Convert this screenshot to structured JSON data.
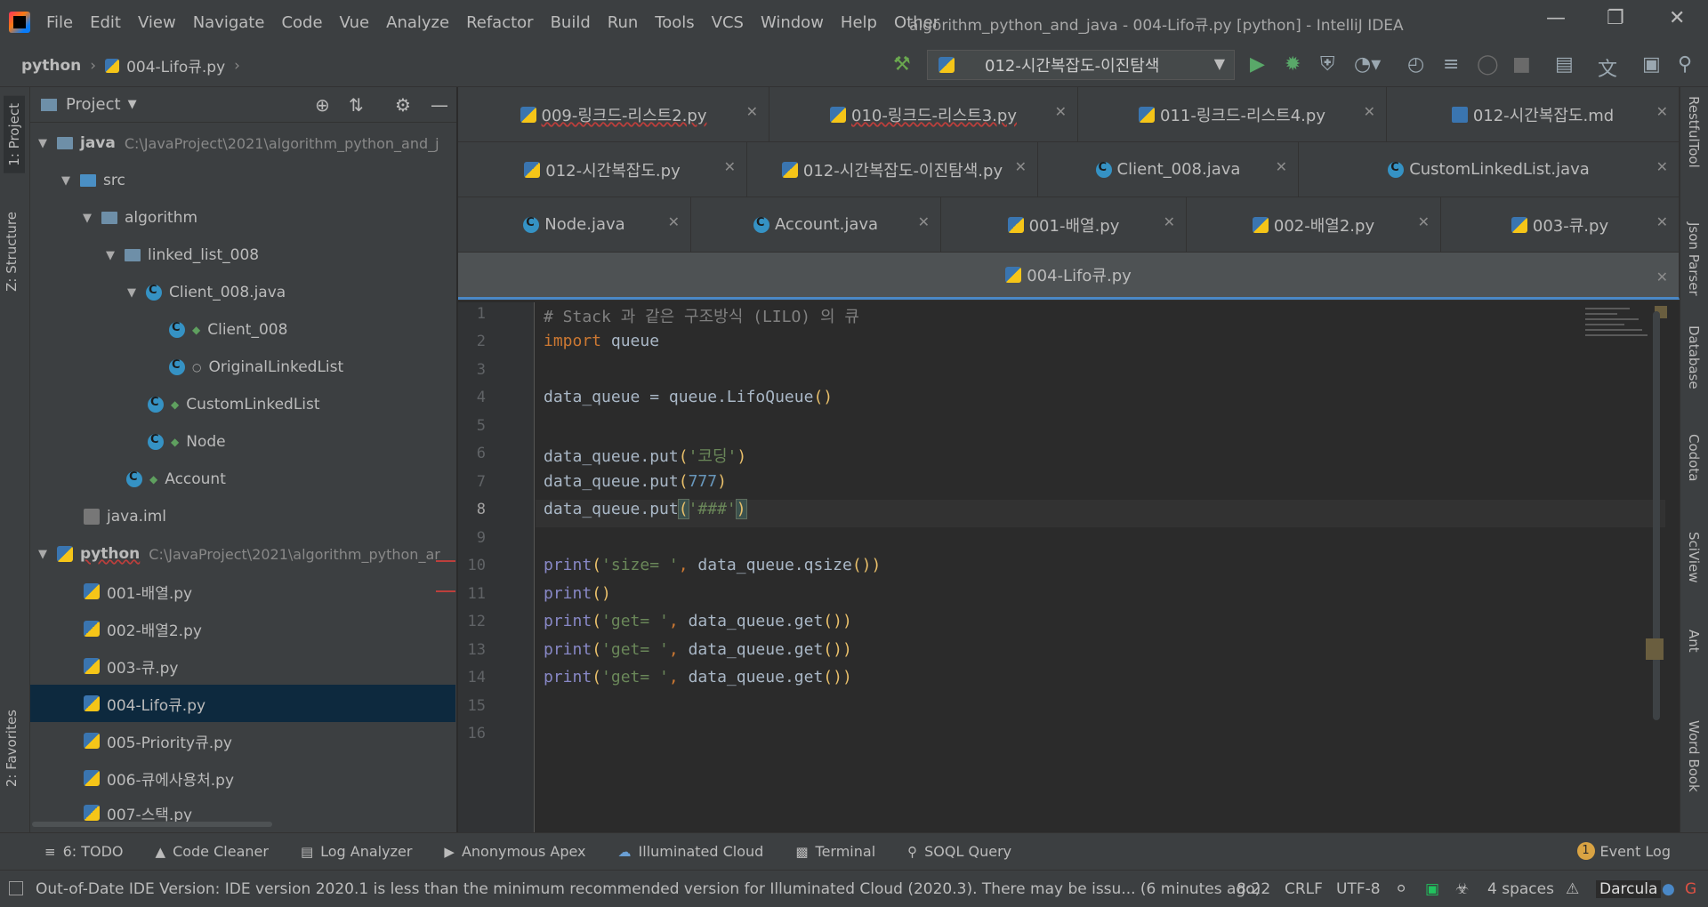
{
  "window": {
    "title": "algorithm_python_and_java - 004-Lifo큐.py [python] - IntelliJ IDEA",
    "menu": [
      "File",
      "Edit",
      "View",
      "Navigate",
      "Code",
      "Vue",
      "Analyze",
      "Refactor",
      "Build",
      "Run",
      "Tools",
      "VCS",
      "Window",
      "Help",
      "Other"
    ]
  },
  "navbar": {
    "root": "python",
    "file": "004-Lifo큐.py",
    "run_config": "012-시간복잡도-이진탐색"
  },
  "left_strip": {
    "project": "1: Project",
    "structure": "Z: Structure",
    "favorites": "2: Favorites"
  },
  "project_panel": {
    "title": "Project",
    "tree": [
      {
        "label": "java",
        "note": "C:\\JavaProject\\2021\\algorithm_python_and_j"
      },
      {
        "label": "src"
      },
      {
        "label": "algorithm"
      },
      {
        "label": "linked_list_008"
      },
      {
        "label": "Client_008.java"
      },
      {
        "label": "Client_008"
      },
      {
        "label": "OriginalLinkedList"
      },
      {
        "label": "CustomLinkedList"
      },
      {
        "label": "Node"
      },
      {
        "label": "Account"
      },
      {
        "label": "java.iml"
      },
      {
        "label": "python",
        "note": "C:\\JavaProject\\2021\\algorithm_python_ar"
      },
      {
        "label": "001-배열.py"
      },
      {
        "label": "002-배열2.py"
      },
      {
        "label": "003-큐.py"
      },
      {
        "label": "004-Lifo큐.py"
      },
      {
        "label": "005-Priority큐.py"
      },
      {
        "label": "006-큐에사용처.py"
      },
      {
        "label": "007-스택.py"
      }
    ]
  },
  "tabs": {
    "row1": [
      "009-링크드-리스트2.py",
      "010-링크드-리스트3.py",
      "011-링크드-리스트4.py",
      "012-시간복잡도.md"
    ],
    "row2": [
      "012-시간복잡도.py",
      "012-시간복잡도-이진탐색.py",
      "Client_008.java",
      "CustomLinkedList.java"
    ],
    "row3": [
      "Node.java",
      "Account.java",
      "001-배열.py",
      "002-배열2.py",
      "003-큐.py"
    ],
    "active": "004-Lifo큐.py"
  },
  "editor": {
    "line_numbers": [
      "1",
      "2",
      "3",
      "4",
      "5",
      "6",
      "7",
      "8",
      "9",
      "10",
      "11",
      "12",
      "13",
      "14",
      "15",
      "16"
    ],
    "current_line": "8"
  },
  "right_strip": [
    "RestfulTool",
    "Json Parser",
    "Database",
    "Codota",
    "SciView",
    "Ant",
    "Word Book"
  ],
  "tool_windows": {
    "todo": "6: TODO",
    "code_cleaner": "Code Cleaner",
    "log_analyzer": "Log Analyzer",
    "anonymous_apex": "Anonymous Apex",
    "illuminated_cloud": "Illuminated Cloud",
    "terminal": "Terminal",
    "soql_query": "SOQL Query",
    "event_log": "Event Log",
    "event_log_count": "1"
  },
  "status": {
    "message": "Out-of-Date IDE Version: IDE version 2020.1 is less than the minimum recommended  version for Illuminated Cloud (2020.3). There may be issu... (6 minutes ago)",
    "position": "8:22",
    "line_sep": "CRLF",
    "encoding": "UTF-8",
    "indent": "4 spaces",
    "theme": "Darcula"
  },
  "colors": {
    "background": "#2b2b2b",
    "panel": "#3c3f41",
    "keyword": "#cc7832",
    "string": "#6a8759",
    "number": "#6897bb",
    "comment": "#808080",
    "selection": "#0d293e",
    "active_tab_underline": "#4a88c7"
  }
}
